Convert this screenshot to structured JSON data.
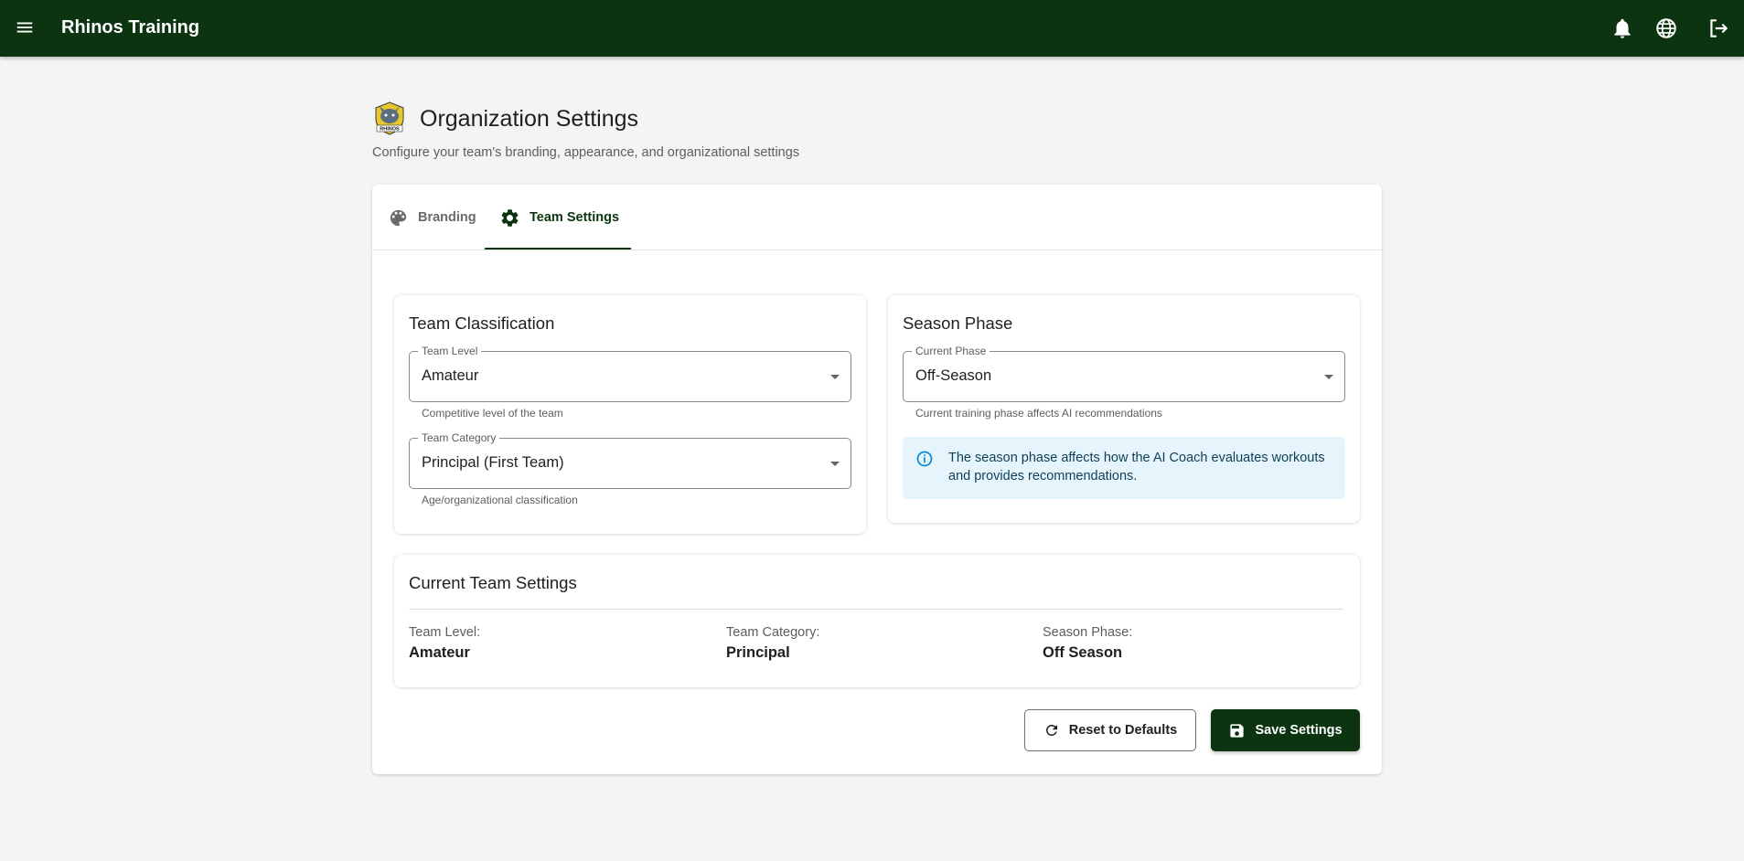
{
  "app": {
    "title": "Rhinos Training"
  },
  "header": {
    "title": "Organization Settings",
    "subtitle": "Configure your team's branding, appearance, and organizational settings",
    "logo_text": "RHINOS"
  },
  "tabs": [
    {
      "label": "Branding",
      "icon": "palette-icon",
      "active": false
    },
    {
      "label": "Team Settings",
      "icon": "gear-icon",
      "active": true
    }
  ],
  "team_classification": {
    "title": "Team Classification",
    "team_level": {
      "label": "Team Level",
      "value": "Amateur",
      "helper": "Competitive level of the team"
    },
    "team_category": {
      "label": "Team Category",
      "value": "Principal (First Team)",
      "helper": "Age/organizational classification"
    }
  },
  "season_phase": {
    "title": "Season Phase",
    "current_phase": {
      "label": "Current Phase",
      "value": "Off-Season",
      "helper": "Current training phase affects AI recommendations"
    },
    "info": "The season phase affects how the AI Coach evaluates workouts and provides recommendations."
  },
  "current_settings": {
    "title": "Current Team Settings",
    "items": [
      {
        "label": "Team Level:",
        "value": "Amateur"
      },
      {
        "label": "Team Category:",
        "value": "Principal"
      },
      {
        "label": "Season Phase:",
        "value": "Off Season"
      }
    ]
  },
  "actions": {
    "reset_label": "Reset to Defaults",
    "save_label": "Save Settings"
  },
  "colors": {
    "brand": "#0c3411",
    "info_background": "#e5f5fb",
    "info_icon": "#0288d1"
  }
}
